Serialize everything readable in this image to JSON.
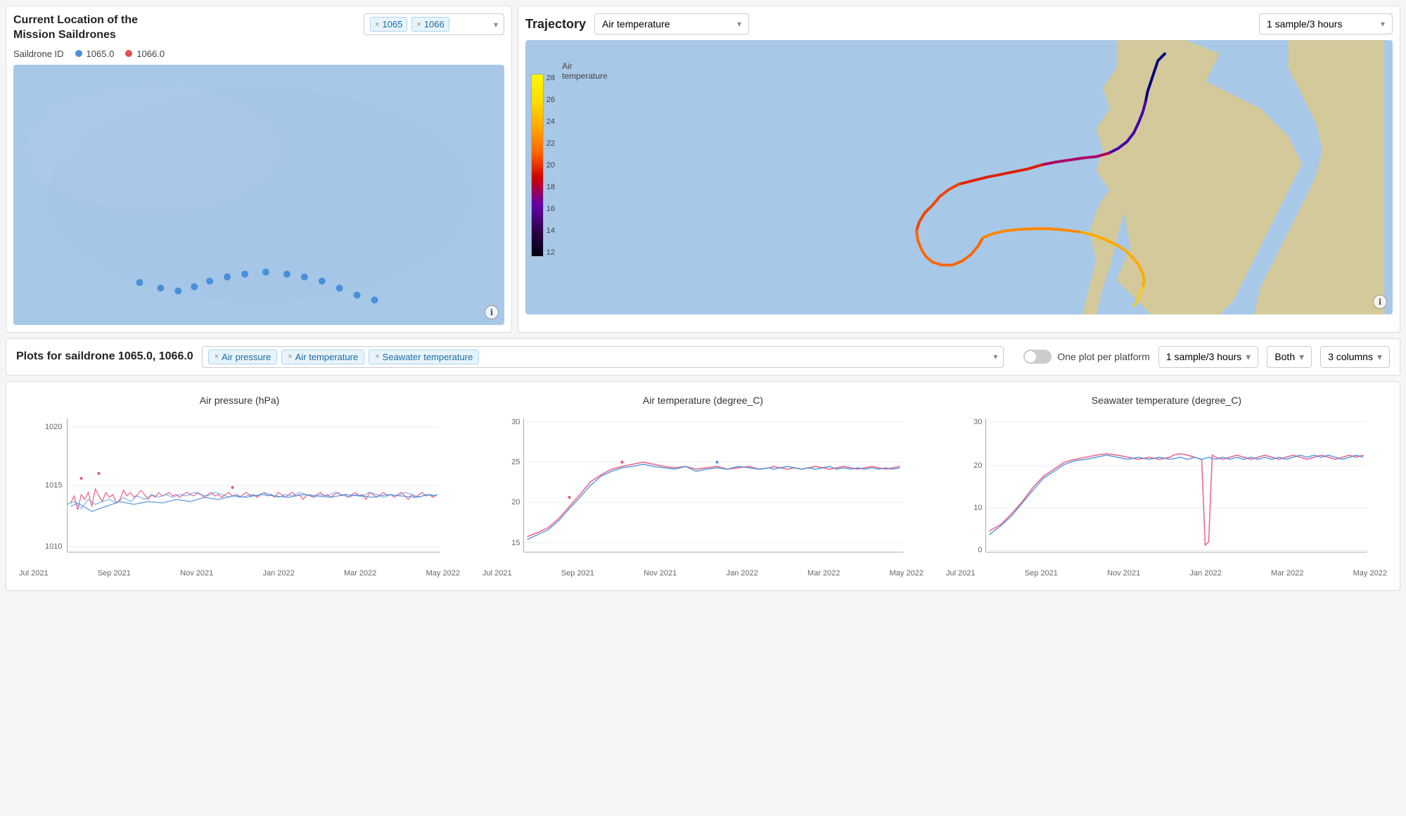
{
  "leftPanel": {
    "title": "Current Location of the\nMission Saildrones",
    "saildrones": [
      "1065",
      "1066"
    ],
    "legendLabel": "Saildrone ID",
    "legendItems": [
      {
        "id": "1065.0",
        "color": "#4a90d9"
      },
      {
        "id": "1066.0",
        "color": "#e05050"
      }
    ],
    "infoButton": "ℹ"
  },
  "trajectoryPanel": {
    "title": "Trajectory",
    "variableLabel": "Air temperature",
    "sampleRate": "1 sample/3 hours",
    "colorbarTitle": "Air temperature",
    "colorbarLabels": [
      "28",
      "26",
      "24",
      "22",
      "20",
      "18",
      "16",
      "14",
      "12"
    ],
    "infoButton": "ℹ"
  },
  "controlsRow": {
    "title": "Plots for saildrone 1065.0, 1066.0",
    "variables": [
      "Air pressure",
      "Air temperature",
      "Seawater temperature"
    ],
    "toggleLabel": "One plot per platform",
    "sampleRate": "1 sample/3 hours",
    "bothLabel": "Both",
    "columnsLabel": "3 columns"
  },
  "charts": [
    {
      "title": "Air pressure (hPa)",
      "yLabels": [
        "1020",
        "1015",
        "1010"
      ],
      "xLabels": [
        "Jul 2021",
        "Sep 2021",
        "Nov 2021",
        "Jan 2022",
        "Mar 2022",
        "May 2022"
      ]
    },
    {
      "title": "Air temperature (degree_C)",
      "yLabels": [
        "30",
        "25",
        "20",
        "15"
      ],
      "xLabels": [
        "Jul 2021",
        "Sep 2021",
        "Nov 2021",
        "Jan 2022",
        "Mar 2022",
        "May 2022"
      ]
    },
    {
      "title": "Seawater temperature (degree_C)",
      "yLabels": [
        "30",
        "20",
        "10",
        "0"
      ],
      "xLabels": [
        "Jul 2021",
        "Sep 2021",
        "Nov 2021",
        "Jan 2022",
        "Mar 2022",
        "May 2022"
      ]
    }
  ]
}
